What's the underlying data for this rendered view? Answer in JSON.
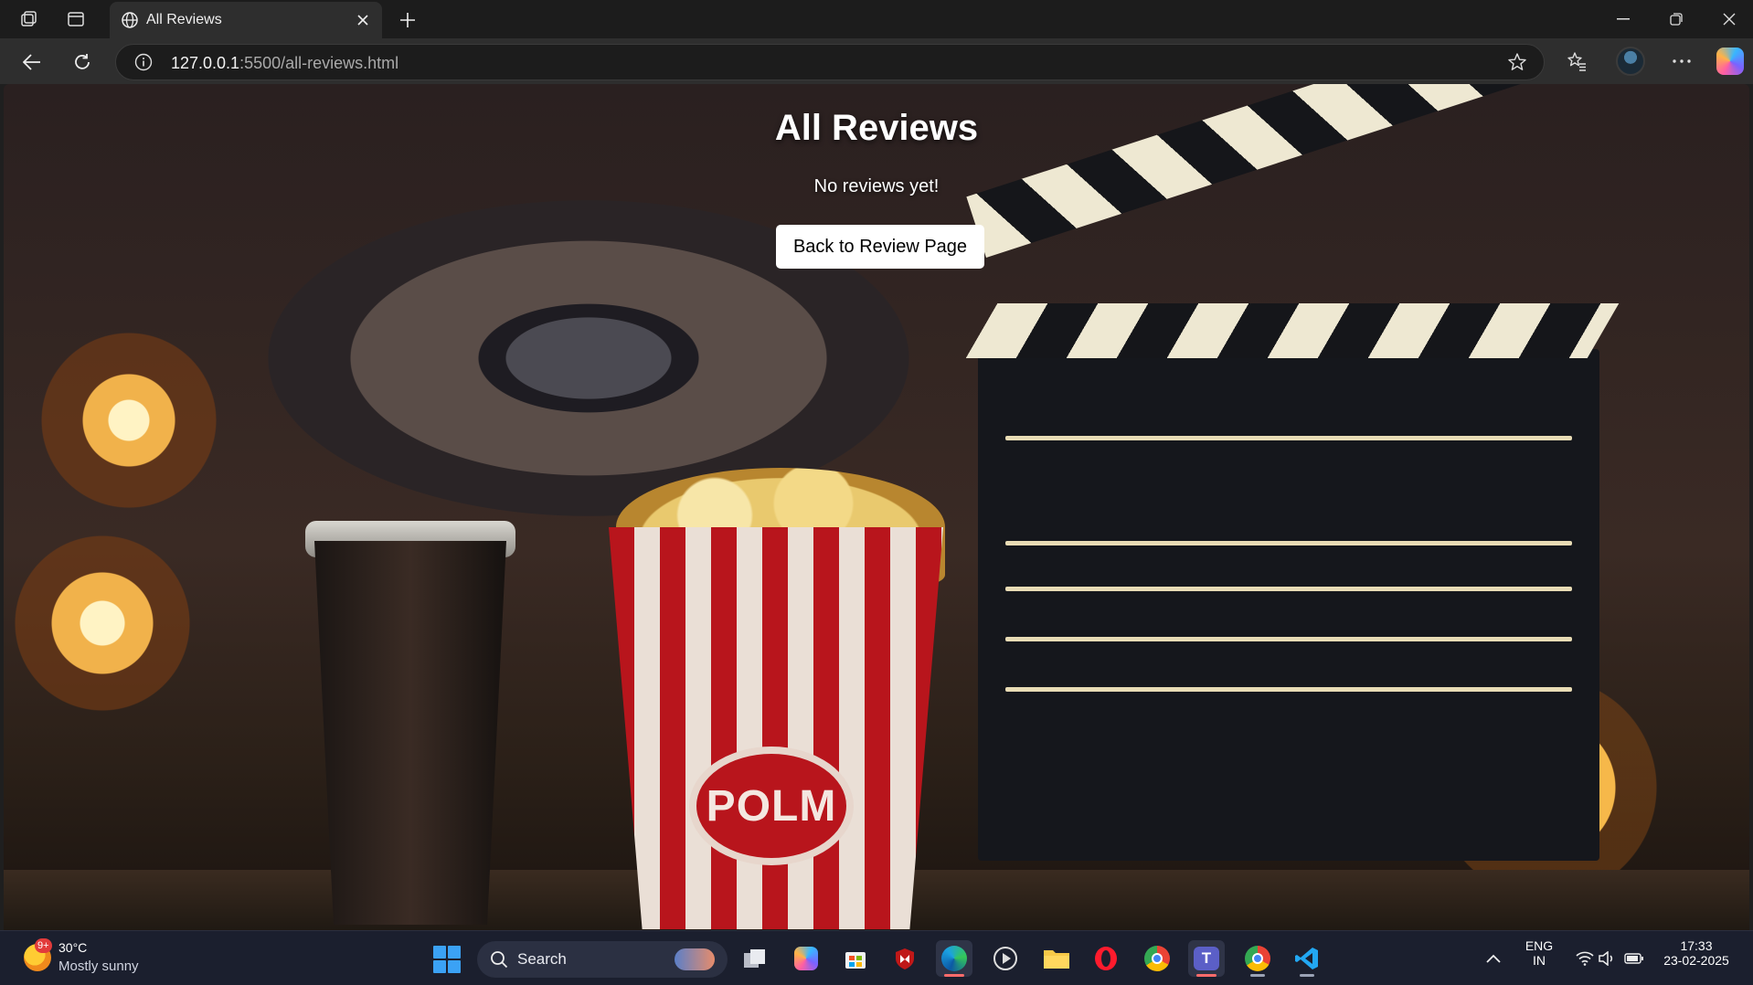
{
  "browser": {
    "tab_title": "All Reviews",
    "url_host": "127.0.0.1",
    "url_rest": ":5500/all-reviews.html"
  },
  "page": {
    "title": "All Reviews",
    "empty_message": "No reviews yet!",
    "back_button_label": "Back to Review Page",
    "background_image_text": "POLM"
  },
  "taskbar": {
    "weather_badge": "9+",
    "temperature": "30°C",
    "condition": "Mostly sunny",
    "search_label": "Search",
    "language_line1": "ENG",
    "language_line2": "IN",
    "time": "17:33",
    "date": "23-02-2025",
    "pinned_apps": [
      "task-view",
      "copilot",
      "microsoft-store",
      "mcafee",
      "edge",
      "media-player",
      "file-explorer",
      "opera",
      "chrome",
      "teams",
      "chrome-profile",
      "vscode"
    ]
  },
  "colors": {
    "accent_blue": "#3ba2f5",
    "button_bg": "#ffffff",
    "popcorn_red": "#b8151c"
  }
}
